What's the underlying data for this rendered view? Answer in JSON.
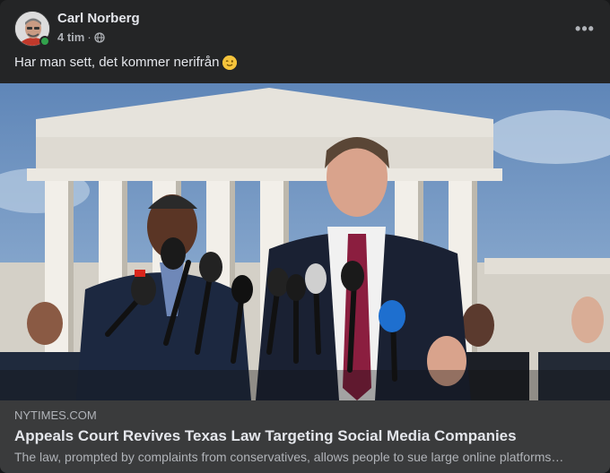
{
  "post": {
    "author": "Carl Norberg",
    "time": "4 tim",
    "separator": "·",
    "privacy_icon": "globe-icon",
    "more_label": "•••",
    "text": "Har man sett, det kommer nerifrån",
    "emoji_icon": "winking-face-icon",
    "online_status": "online"
  },
  "link": {
    "domain": "NYTIMES.COM",
    "title": "Appeals Court Revives Texas Law Targeting Social Media Companies",
    "description": "The law, prompted by complaints from conservatives, allows people to sue large online platforms…"
  },
  "colors": {
    "card_bg": "#242526",
    "link_bg": "#3a3b3c",
    "primary_text": "#e4e6eb",
    "secondary_text": "#b0b3b8",
    "online": "#31a24c"
  }
}
